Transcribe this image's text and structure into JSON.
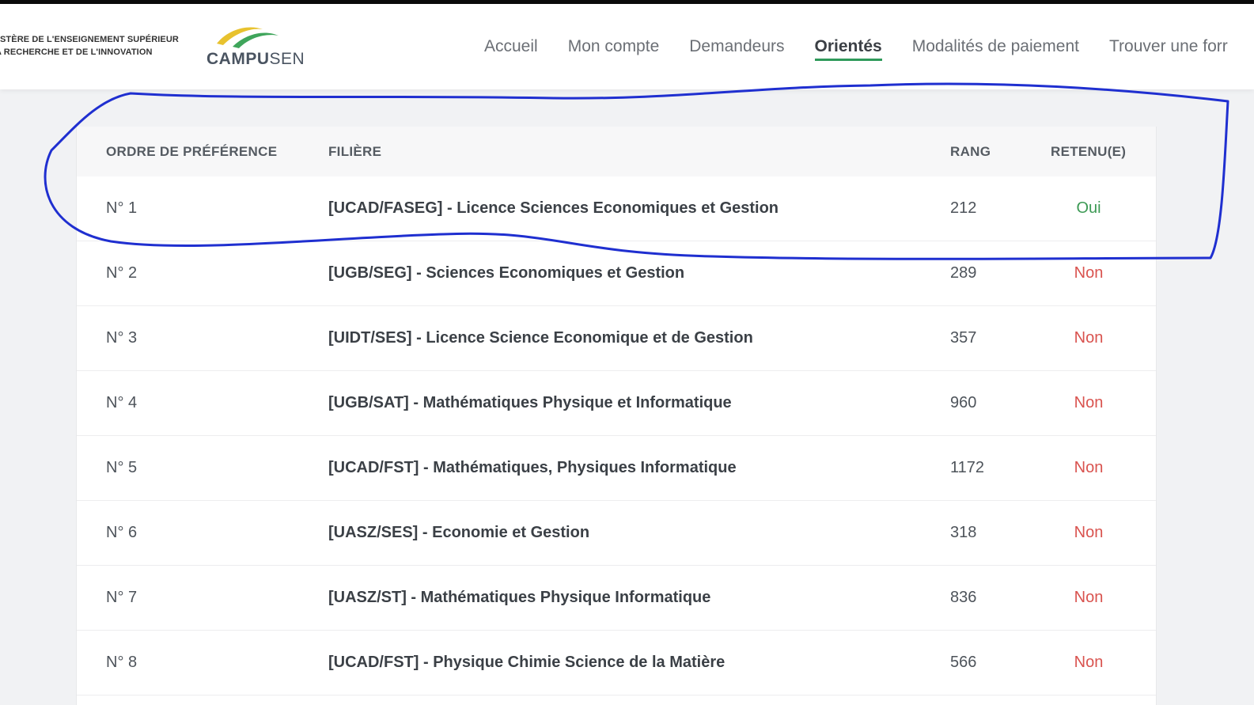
{
  "header": {
    "ministry_line1": "STÈRE DE L'ENSEIGNEMENT SUPÉRIEUR",
    "ministry_line2": "A RECHERCHE ET DE L'INNOVATION",
    "logo_text_bold": "CAMPU",
    "logo_text_light": "SEN",
    "logo_icon": "campusen-swoosh-logo",
    "colors": {
      "logo_yellow": "#e8c22e",
      "logo_green": "#3fa55b",
      "active_underline": "#2f9a5a"
    }
  },
  "nav": {
    "items": [
      {
        "label": "Accueil",
        "active": false
      },
      {
        "label": "Mon compte",
        "active": false
      },
      {
        "label": "Demandeurs",
        "active": false
      },
      {
        "label": "Orientés",
        "active": true
      },
      {
        "label": "Modalités de paiement",
        "active": false
      },
      {
        "label": "Trouver une forr",
        "active": false
      }
    ]
  },
  "table": {
    "columns": [
      "ORDRE DE PRÉFÉRENCE",
      "FILIÈRE",
      "RANG",
      "RETENU(E)"
    ],
    "rows": [
      {
        "pref": "N° 1",
        "filiere": "[UCAD/FASEG] - Licence Sciences Economiques et Gestion",
        "rang": "212",
        "retenu": "Oui"
      },
      {
        "pref": "N° 2",
        "filiere": "[UGB/SEG] - Sciences Economiques et Gestion",
        "rang": "289",
        "retenu": "Non"
      },
      {
        "pref": "N° 3",
        "filiere": "[UIDT/SES] - Licence Science Economique et de Gestion",
        "rang": "357",
        "retenu": "Non"
      },
      {
        "pref": "N° 4",
        "filiere": "[UGB/SAT] - Mathématiques Physique et Informatique",
        "rang": "960",
        "retenu": "Non"
      },
      {
        "pref": "N° 5",
        "filiere": "[UCAD/FST] - Mathématiques, Physiques Informatique",
        "rang": "1172",
        "retenu": "Non"
      },
      {
        "pref": "N° 6",
        "filiere": "[UASZ/SES] - Economie et Gestion",
        "rang": "318",
        "retenu": "Non"
      },
      {
        "pref": "N° 7",
        "filiere": "[UASZ/ST] - Mathématiques Physique Informatique",
        "rang": "836",
        "retenu": "Non"
      },
      {
        "pref": "N° 8",
        "filiere": "[UCAD/FST] - Physique Chimie Science de la Matière",
        "rang": "566",
        "retenu": "Non"
      }
    ],
    "colors": {
      "oui": "#3d9a55",
      "non": "#d9534f"
    }
  },
  "annotation": {
    "shape": "hand-drawn-circle",
    "color": "#1f2fd0",
    "highlighted_row": "N° 1"
  }
}
